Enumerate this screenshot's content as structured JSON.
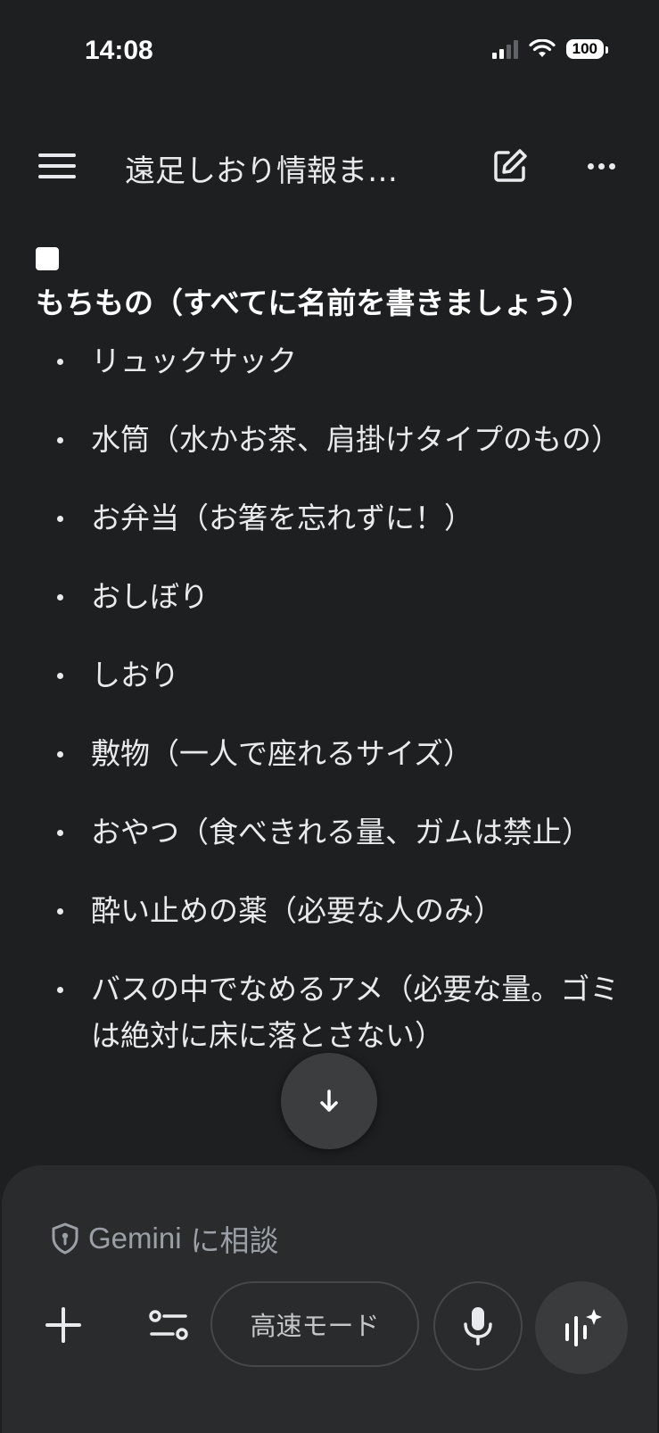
{
  "status_bar": {
    "time": "14:08",
    "battery": "100"
  },
  "header": {
    "title": "遠足しおり情報ま…"
  },
  "content": {
    "heading": "もちもの（すべてに名前を書きましょう）",
    "items": [
      "リュックサック",
      "水筒（水かお茶、肩掛けタイプのもの）",
      "お弁当（お箸を忘れずに！）",
      "おしぼり",
      "しおり",
      "敷物（一人で座れるサイズ）",
      "おやつ（食べきれる量、ガムは禁止）",
      "酔い止めの薬（必要な人のみ）",
      "バスの中でなめるアメ（必要な量。ゴミは絶対に床に落とさない）"
    ]
  },
  "composer": {
    "prompt_brand": "Gemini",
    "prompt_text": "に相談",
    "mode_label": "高速モード"
  },
  "icons": [
    "menu-icon",
    "edit-icon",
    "more-icon",
    "arrow-down-icon",
    "shield-icon",
    "plus-icon",
    "tune-icon",
    "mic-icon",
    "live-sparkle-icon"
  ]
}
